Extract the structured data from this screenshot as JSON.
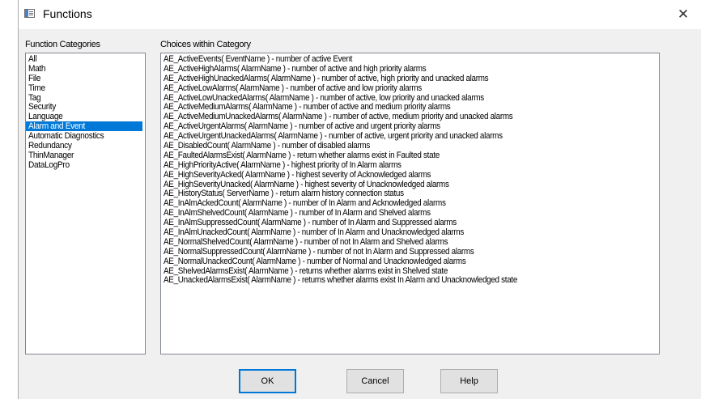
{
  "window": {
    "title": "Functions",
    "close_glyph": "✕"
  },
  "categories": {
    "label": "Function Categories",
    "selected": "Alarm and Event",
    "items": [
      "All",
      "Math",
      "File",
      "Time",
      "Tag",
      "Security",
      "Language",
      "Alarm and Event",
      "Automatic Diagnostics",
      "Redundancy",
      "ThinManager",
      "DataLogPro"
    ]
  },
  "choices": {
    "label": "Choices within Category",
    "items": [
      "AE_ActiveEvents( EventName ) - number of active Event",
      "AE_ActiveHighAlarms( AlarmName ) - number of active and high priority alarms",
      "AE_ActiveHighUnackedAlarms( AlarmName ) - number of active, high priority and unacked alarms",
      "AE_ActiveLowAlarms( AlarmName ) - number of active and low priority alarms",
      "AE_ActiveLowUnackedAlarms( AlarmName ) - number of active, low priority and unacked alarms",
      "AE_ActiveMediumAlarms( AlarmName ) - number of active and medium priority alarms",
      "AE_ActiveMediumUnackedAlarms( AlarmName ) - number of active, medium priority and unacked alarms",
      "AE_ActiveUrgentAlarms( AlarmName ) - number of active and urgent priority alarms",
      "AE_ActiveUrgentUnackedAlarms( AlarmName ) - number of active, urgent priority and unacked alarms",
      "AE_DisabledCount( AlarmName ) - number of disabled alarms",
      "AE_FaultedAlarmsExist( AlarmName ) - return whether alarms exist in Faulted state",
      "AE_HighPriorityActive( AlarmName ) - highest priority of In Alarm alarms",
      "AE_HighSeverityAcked( AlarmName ) - highest severity of Acknowledged alarms",
      "AE_HighSeverityUnacked( AlarmName ) - highest severity of Unacknowledged alarms",
      "AE_HistoryStatus( ServerName ) - return alarm history connection status",
      "AE_InAlmAckedCount( AlarmName ) - number of In Alarm and Acknowledged alarms",
      "AE_InAlmShelvedCount( AlarmName ) - number of In Alarm and Shelved alarms",
      "AE_InAlmSuppressedCount( AlarmName ) - number of In Alarm and Suppressed alarms",
      "AE_InAlmUnackedCount( AlarmName ) - number of In Alarm and Unacknowledged alarms",
      "AE_NormalShelvedCount( AlarmName ) - number of not In Alarm and Shelved alarms",
      "AE_NormalSuppressedCount( AlarmName ) - number of not In Alarm and Suppressed alarms",
      "AE_NormalUnackedCount( AlarmName ) - number of Normal and Unacknowledged alarms",
      "AE_ShelvedAlarmsExist( AlarmName ) - returns whether alarms exist in Shelved state",
      "AE_UnackedAlarmsExist( AlarmName ) - returns whether alarms exist In Alarm and Unacknowledged state"
    ]
  },
  "buttons": {
    "ok": "OK",
    "cancel": "Cancel",
    "help": "Help"
  },
  "colors": {
    "selection": "#0078d7",
    "dialog_bg": "#f0f0f0",
    "default_button_border": "#0078d7"
  }
}
